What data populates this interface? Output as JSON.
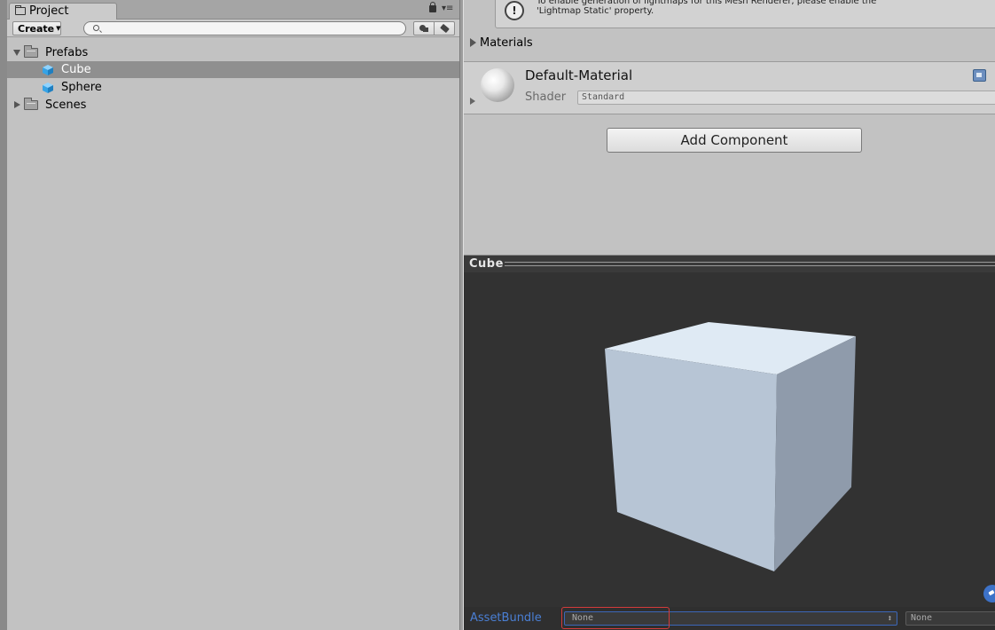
{
  "project": {
    "tab_label": "Project",
    "create_label": "Create",
    "search_placeholder": "",
    "tree": [
      {
        "label": "Prefabs",
        "kind": "folder",
        "expanded": true
      },
      {
        "label": "Cube",
        "kind": "prefab",
        "selected": true
      },
      {
        "label": "Sphere",
        "kind": "prefab"
      },
      {
        "label": "Scenes",
        "kind": "folder",
        "expanded": false
      }
    ]
  },
  "inspector": {
    "lightmap_warning": "To enable generation of lightmaps for this Mesh Renderer, please enable the\n'Lightmap Static' property.",
    "info_icon_glyph": "!",
    "materials_label": "Materials",
    "material_name": "Default-Material",
    "shader_label": "Shader",
    "shader_value": "Standard",
    "add_component_label": "Add Component"
  },
  "preview": {
    "title": "Cube",
    "assetbundle_label": "AssetBundle",
    "assetbundle_name": "None",
    "assetbundle_variant": "None",
    "updown_glyph": "↕"
  },
  "colors": {
    "selection": "#8f8f8f",
    "prefab_blue": "#36a3e6",
    "assetbundle_blue": "#4a7fd4",
    "highlight_red": "#d43b3b"
  },
  "icons": {
    "project_tab": "folder-tab-icon",
    "lock": "lock-icon",
    "search": "search-icon",
    "filter_type": "filter-by-type-icon",
    "filter_label": "filter-by-label-icon",
    "material_settings": "settings-icon",
    "preview_corner": "tag-icon"
  }
}
